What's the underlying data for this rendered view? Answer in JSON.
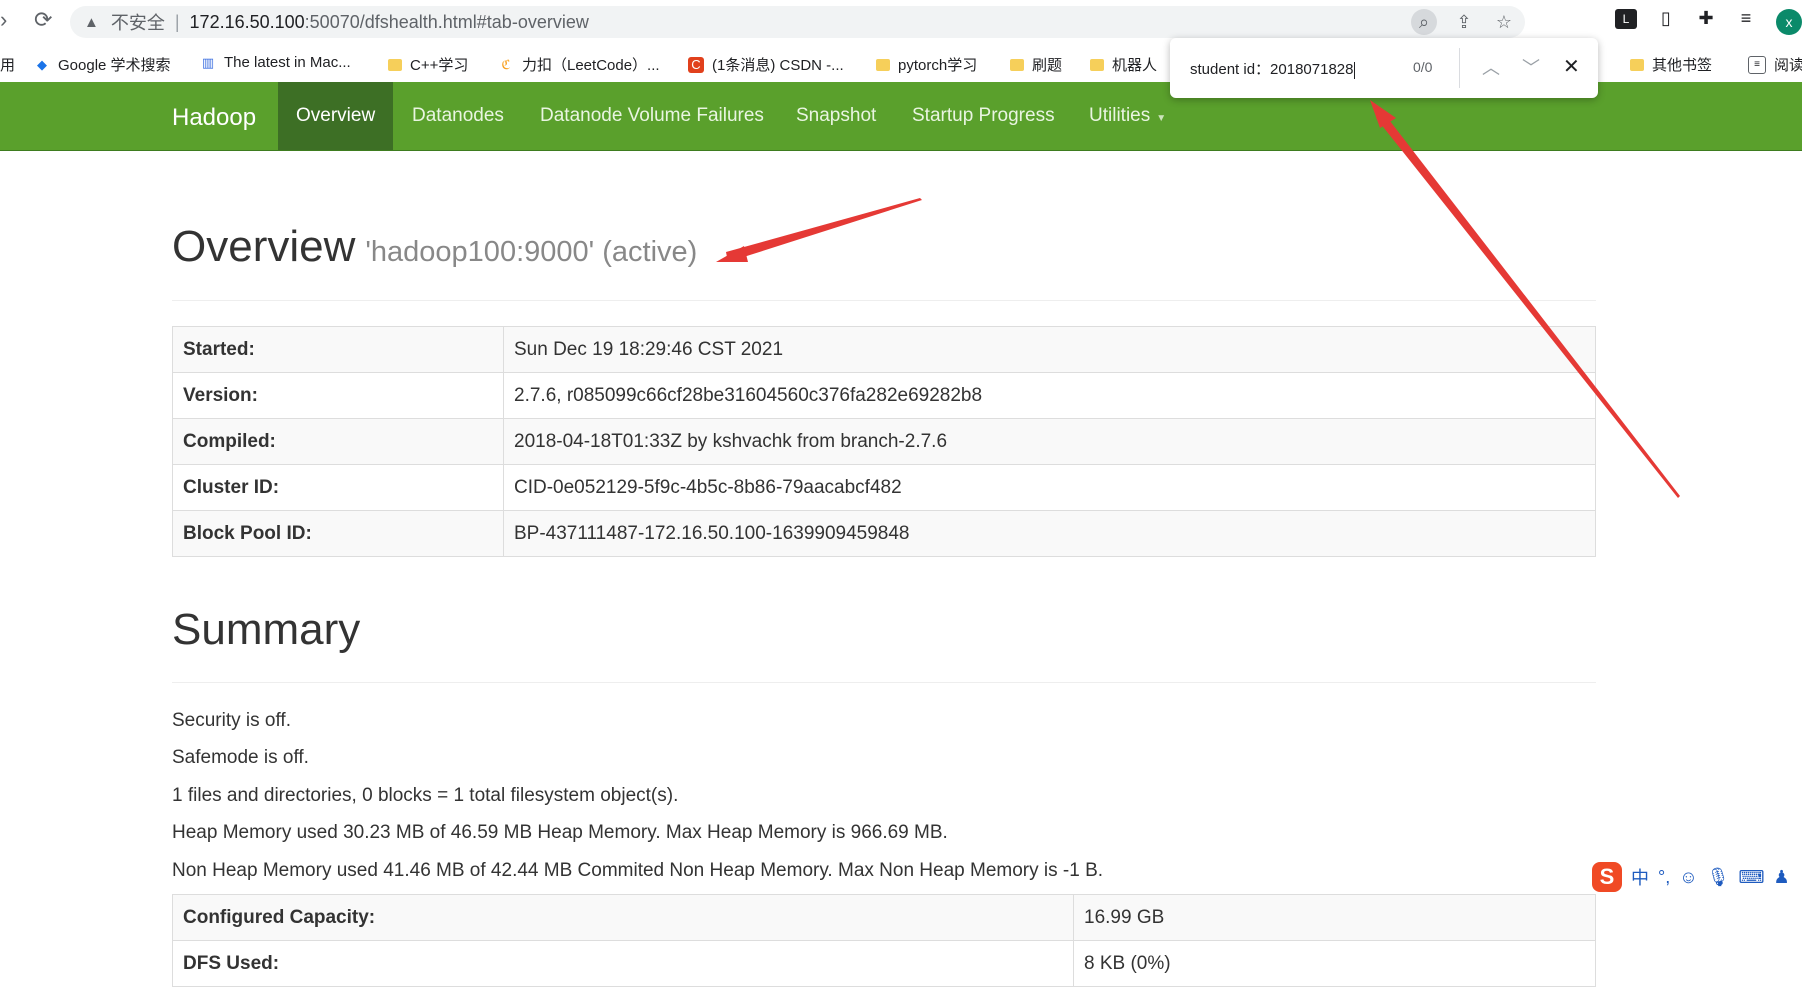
{
  "browser": {
    "security_label": "不安全",
    "url_host": "172.16.50.100",
    "url_path": ":50070/dfshealth.html#tab-overview"
  },
  "bookmarks": [
    {
      "label": "用"
    },
    {
      "label": "Google 学术搜索"
    },
    {
      "label": "The latest in Mac..."
    },
    {
      "label": "C++学习"
    },
    {
      "label": "力扣（LeetCode）..."
    },
    {
      "label": "(1条消息) CSDN -..."
    },
    {
      "label": "pytorch学习"
    },
    {
      "label": "刷题"
    },
    {
      "label": "机器人"
    },
    {
      "label": "其他书签"
    },
    {
      "label": "阅读"
    }
  ],
  "findbar": {
    "query": "student id：2018071828",
    "count": "0/0"
  },
  "navbar": {
    "brand": "Hadoop",
    "items": [
      "Overview",
      "Datanodes",
      "Datanode Volume Failures",
      "Snapshot",
      "Startup Progress",
      "Utilities"
    ]
  },
  "overview": {
    "title": "Overview",
    "subtitle": "'hadoop100:9000' (active)",
    "rows": [
      {
        "key": "Started:",
        "value": "Sun Dec 19 18:29:46 CST 2021"
      },
      {
        "key": "Version:",
        "value": "2.7.6, r085099c66cf28be31604560c376fa282e69282b8"
      },
      {
        "key": "Compiled:",
        "value": "2018-04-18T01:33Z by kshvachk from branch-2.7.6"
      },
      {
        "key": "Cluster ID:",
        "value": "CID-0e052129-5f9c-4b5c-8b86-79aacabcf482"
      },
      {
        "key": "Block Pool ID:",
        "value": "BP-437111487-172.16.50.100-1639909459848"
      }
    ]
  },
  "summary": {
    "title": "Summary",
    "lines": [
      "Security is off.",
      "Safemode is off.",
      "1 files and directories, 0 blocks = 1 total filesystem object(s).",
      "Heap Memory used 30.23 MB of 46.59 MB Heap Memory. Max Heap Memory is 966.69 MB.",
      "Non Heap Memory used 41.46 MB of 42.44 MB Commited Non Heap Memory. Max Non Heap Memory is -1 B."
    ],
    "rows": [
      {
        "key": "Configured Capacity:",
        "value": "16.99 GB"
      },
      {
        "key": "DFS Used:",
        "value": "8 KB (0%)"
      }
    ]
  },
  "ime": {
    "logo": "S",
    "lang": "中"
  },
  "colors": {
    "navbar": "#5aa02c",
    "nav_active": "#3d6f25",
    "arrow": "#e53935"
  }
}
